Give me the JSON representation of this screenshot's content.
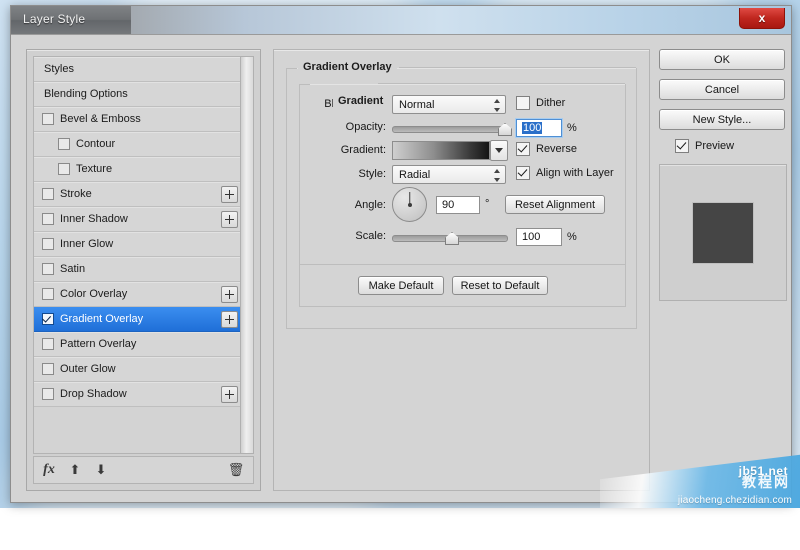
{
  "window": {
    "title": "Layer Style",
    "close_label": "x"
  },
  "sidebar": {
    "items": [
      {
        "label": "Styles",
        "type": "plain",
        "checkbox": null,
        "plus": false,
        "selected": false
      },
      {
        "label": "Blending Options",
        "type": "plain",
        "checkbox": null,
        "plus": false,
        "selected": false
      },
      {
        "label": "Bevel & Emboss",
        "type": "normal",
        "checkbox": "unchecked",
        "plus": false,
        "selected": false
      },
      {
        "label": "Contour",
        "type": "indent",
        "checkbox": "unchecked",
        "plus": false,
        "selected": false
      },
      {
        "label": "Texture",
        "type": "indent",
        "checkbox": "unchecked",
        "plus": false,
        "selected": false
      },
      {
        "label": "Stroke",
        "type": "normal",
        "checkbox": "unchecked",
        "plus": true,
        "selected": false
      },
      {
        "label": "Inner Shadow",
        "type": "normal",
        "checkbox": "unchecked",
        "plus": true,
        "selected": false
      },
      {
        "label": "Inner Glow",
        "type": "normal",
        "checkbox": "unchecked",
        "plus": false,
        "selected": false
      },
      {
        "label": "Satin",
        "type": "normal",
        "checkbox": "unchecked",
        "plus": false,
        "selected": false
      },
      {
        "label": "Color Overlay",
        "type": "normal",
        "checkbox": "unchecked",
        "plus": true,
        "selected": false
      },
      {
        "label": "Gradient Overlay",
        "type": "normal",
        "checkbox": "checked",
        "plus": true,
        "selected": true
      },
      {
        "label": "Pattern Overlay",
        "type": "normal",
        "checkbox": "unchecked",
        "plus": false,
        "selected": false
      },
      {
        "label": "Outer Glow",
        "type": "normal",
        "checkbox": "unchecked",
        "plus": false,
        "selected": false
      },
      {
        "label": "Drop Shadow",
        "type": "normal",
        "checkbox": "unchecked",
        "plus": true,
        "selected": false
      }
    ],
    "toolbar": {
      "fx": "fx",
      "move_up": "⬆",
      "move_down": "⬇",
      "delete": "🗑"
    }
  },
  "main": {
    "group_title": "Gradient Overlay",
    "subgroup_title": "Gradient",
    "blend_mode": {
      "label": "Blend Mode:",
      "value": "Normal"
    },
    "dither": {
      "label": "Dither",
      "checked": false
    },
    "opacity": {
      "label": "Opacity:",
      "value": "100",
      "unit": "%",
      "slider_percent": 100
    },
    "gradient": {
      "label": "Gradient:"
    },
    "reverse": {
      "label": "Reverse",
      "checked": true
    },
    "style": {
      "label": "Style:",
      "value": "Radial"
    },
    "align_with_layer": {
      "label": "Align with Layer",
      "checked": true
    },
    "angle": {
      "label": "Angle:",
      "value": "90",
      "unit": "°"
    },
    "reset_alignment": "Reset Alignment",
    "scale": {
      "label": "Scale:",
      "value": "100",
      "unit": "%",
      "slider_percent": 50
    },
    "make_default": "Make Default",
    "reset_to_default": "Reset to Default"
  },
  "right": {
    "ok": "OK",
    "cancel": "Cancel",
    "new_style": "New Style...",
    "preview": {
      "label": "Preview",
      "checked": true
    }
  },
  "watermark": {
    "site": "jb51.net",
    "chinese": "教程网",
    "url": "jiaocheng.chezidian.com"
  },
  "colors": {
    "selection_blue": "#2a6fc9",
    "preview_square": "#454545",
    "close_red": "#c0271f"
  }
}
